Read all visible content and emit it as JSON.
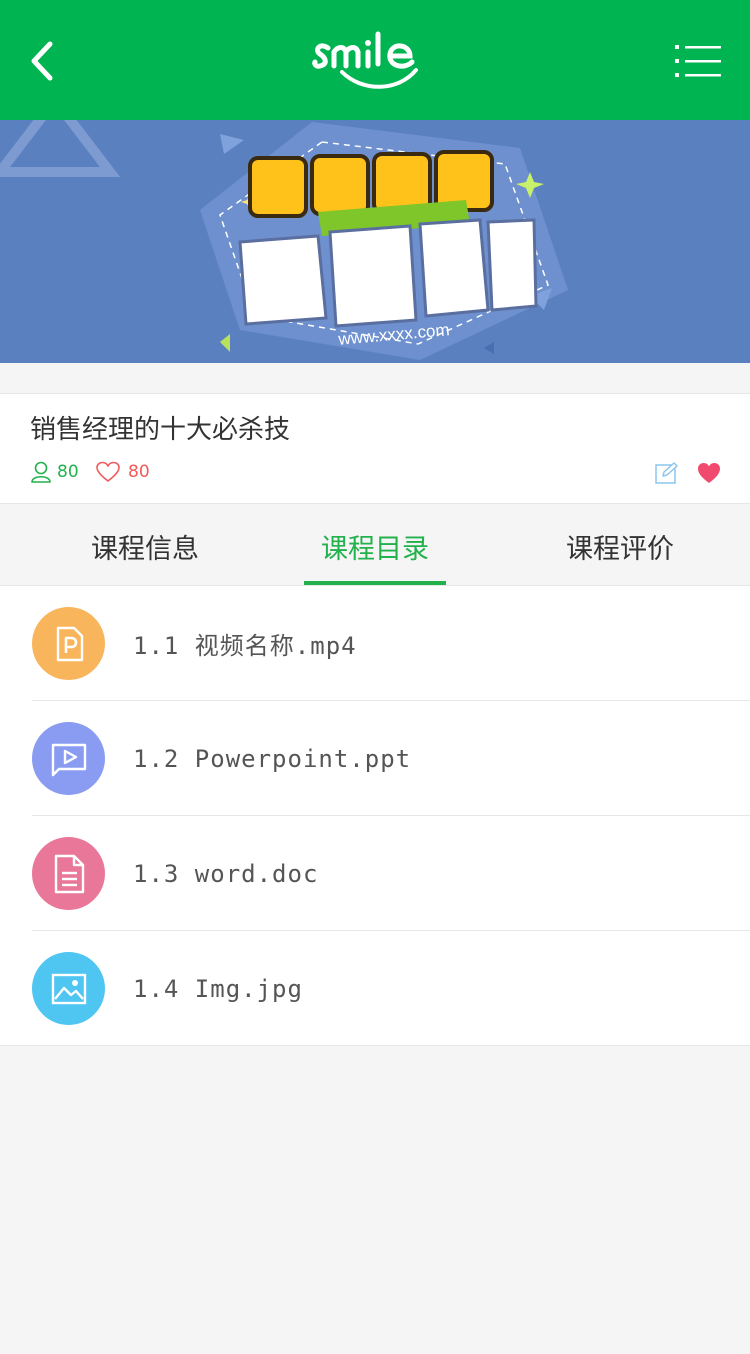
{
  "header": {
    "back_icon": "chevron-left-icon",
    "logo_text": "smile",
    "menu_icon": "list-menu-icon",
    "background_color": "#00b451"
  },
  "banner": {
    "url_text": "www.xxxx.com",
    "background_color": "#5b80c0"
  },
  "course": {
    "title": "销售经理的十大必杀技",
    "learners_count": "80",
    "likes_count": "80",
    "edit_icon": "edit-icon",
    "favorite_icon": "heart-filled-icon"
  },
  "tabs": [
    {
      "label": "课程信息",
      "active": false
    },
    {
      "label": "课程目录",
      "active": true
    },
    {
      "label": "课程评价",
      "active": false
    }
  ],
  "accent_color": "#22b14c",
  "catalog": [
    {
      "label": "1.1 视频名称.mp4",
      "icon": "ppt-file-icon",
      "color": "#f9b55c"
    },
    {
      "label": "1.2 Powerpoint.ppt",
      "icon": "video-play-icon",
      "color": "#8a9cf2"
    },
    {
      "label": "1.3 word.doc",
      "icon": "document-icon",
      "color": "#e9779a"
    },
    {
      "label": "1.4 Img.jpg",
      "icon": "image-icon",
      "color": "#4fc5f2"
    }
  ]
}
